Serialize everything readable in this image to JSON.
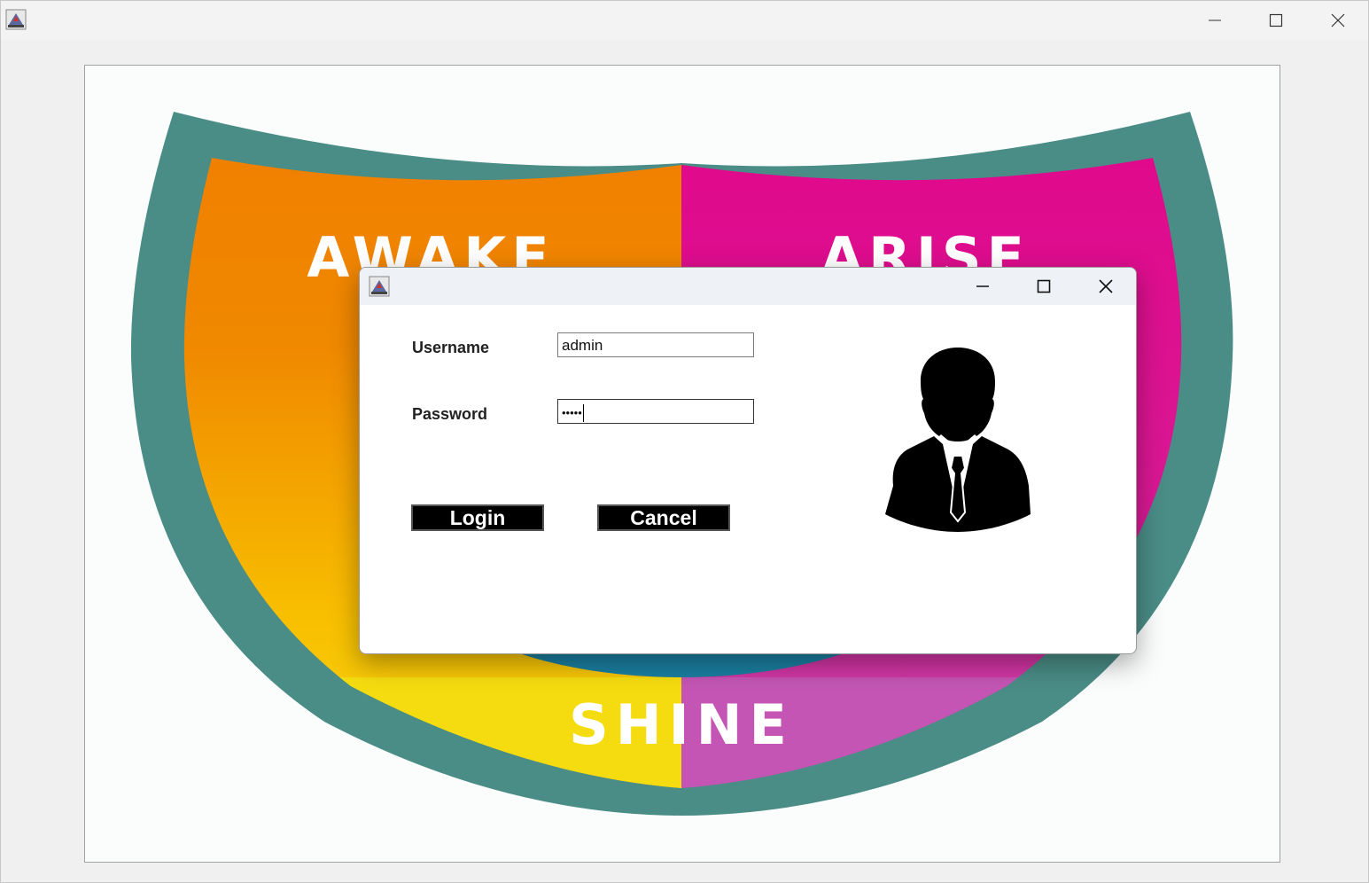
{
  "main_window": {
    "title": "",
    "controls": {
      "minimize": "minimize",
      "maximize": "maximize",
      "close": "close"
    }
  },
  "banner": {
    "words": [
      "AWAKE",
      "ARISE",
      "SHINE"
    ],
    "colors": {
      "border": "#4a8c86",
      "orange": "#f07d00",
      "magenta": "#e0088a",
      "yellow": "#f8d000",
      "pink": "#c455b4"
    }
  },
  "login_dialog": {
    "title": "",
    "username_label": "Username",
    "username_value": "admin",
    "password_label": "Password",
    "password_value": "•••••",
    "login_button": "Login",
    "cancel_button": "Cancel",
    "avatar_icon": "user-silhouette-icon"
  }
}
